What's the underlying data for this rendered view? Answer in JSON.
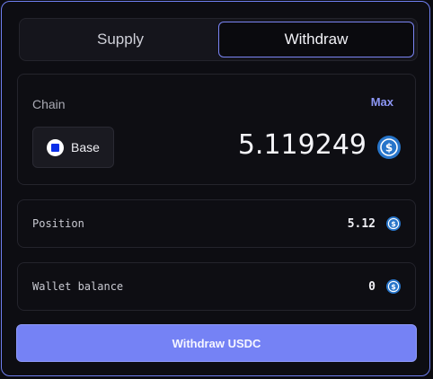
{
  "tabs": [
    {
      "label": "Supply",
      "active": false
    },
    {
      "label": "Withdraw",
      "active": true
    }
  ],
  "amount_card": {
    "chain_label": "Chain",
    "max_label": "Max",
    "chain": {
      "name": "Base",
      "icon": "base-chain-icon"
    },
    "amount": "5.119249",
    "token_icon": "usdc-icon"
  },
  "position": {
    "label": "Position",
    "value": "5.12",
    "token_icon": "usdc-icon"
  },
  "wallet_balance": {
    "label": "Wallet balance",
    "value": "0",
    "token_icon": "usdc-icon"
  },
  "submit_label": "Withdraw USDC",
  "colors": {
    "accent": "#7582f5",
    "accent_border": "#6f7ff0",
    "usdc": "#2775ca",
    "base_blue": "#0a2ee8",
    "background": "#0b0b10"
  }
}
